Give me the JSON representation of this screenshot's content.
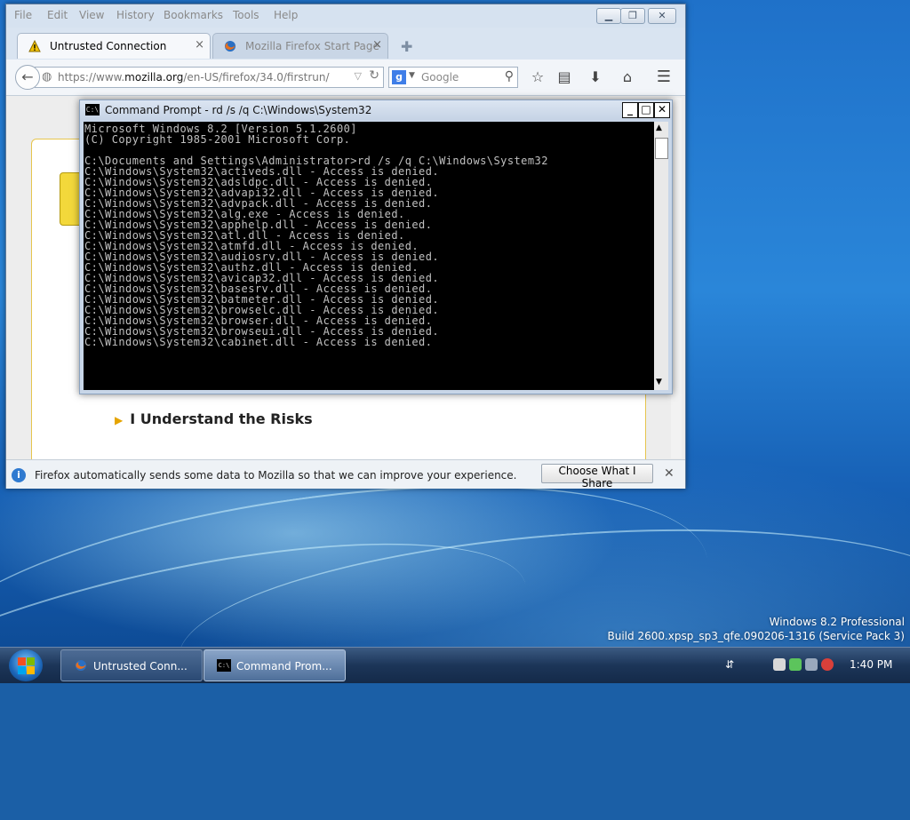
{
  "firefox": {
    "menu": [
      "File",
      "Edit",
      "View",
      "History",
      "Bookmarks",
      "Tools",
      "Help"
    ],
    "tabs": [
      {
        "label": "Untrusted Connection",
        "close": "×"
      },
      {
        "label": "Mozilla Firefox Start Page",
        "close": "×"
      }
    ],
    "url": {
      "prefix": "https://www.",
      "domain": "mozilla.org",
      "path": "/en-US/firefox/34.0/firstrun/"
    },
    "search": {
      "placeholder": "Google",
      "engine_letter": "g"
    },
    "page": {
      "risks_label": "I Understand the Risks"
    },
    "notification": {
      "text": "Firefox automatically sends some data to Mozilla so that we can improve your experience.",
      "button": "Choose What I Share"
    }
  },
  "cmd": {
    "title": "Command Prompt - rd /s /q C:\\Windows\\System32",
    "lines": [
      "Microsoft Windows 8.2 [Version 5.1.2600]",
      "(C) Copyright 1985-2001 Microsoft Corp.",
      "",
      "C:\\Documents and Settings\\Administrator>rd /s /q C:\\Windows\\System32",
      "C:\\Windows\\System32\\activeds.dll - Access is denied.",
      "C:\\Windows\\System32\\adsldpc.dll - Access is denied.",
      "C:\\Windows\\System32\\advapi32.dll - Access is denied.",
      "C:\\Windows\\System32\\advpack.dll - Access is denied.",
      "C:\\Windows\\System32\\alg.exe - Access is denied.",
      "C:\\Windows\\System32\\apphelp.dll - Access is denied.",
      "C:\\Windows\\System32\\atl.dll - Access is denied.",
      "C:\\Windows\\System32\\atmfd.dll - Access is denied.",
      "C:\\Windows\\System32\\audiosrv.dll - Access is denied.",
      "C:\\Windows\\System32\\authz.dll - Access is denied.",
      "C:\\Windows\\System32\\avicap32.dll - Access is denied.",
      "C:\\Windows\\System32\\basesrv.dll - Access is denied.",
      "C:\\Windows\\System32\\batmeter.dll - Access is denied.",
      "C:\\Windows\\System32\\browselc.dll - Access is denied.",
      "C:\\Windows\\System32\\browser.dll - Access is denied.",
      "C:\\Windows\\System32\\browseui.dll - Access is denied.",
      "C:\\Windows\\System32\\cabinet.dll - Access is denied."
    ]
  },
  "desktop": {
    "os_name": "Windows 8.2 Professional",
    "os_build": "Build 2600.xpsp_sp3_qfe.090206-1316 (Service Pack 3)"
  },
  "taskbar": {
    "items": [
      {
        "label": "Untrusted Conn..."
      },
      {
        "label": "Command Prom..."
      }
    ],
    "clock": "1:40 PM"
  },
  "colors": {
    "desktop": "#2a86d9",
    "taskbar": "#1c3558",
    "console_bg": "#000000",
    "console_fg": "#c0c0c0"
  }
}
